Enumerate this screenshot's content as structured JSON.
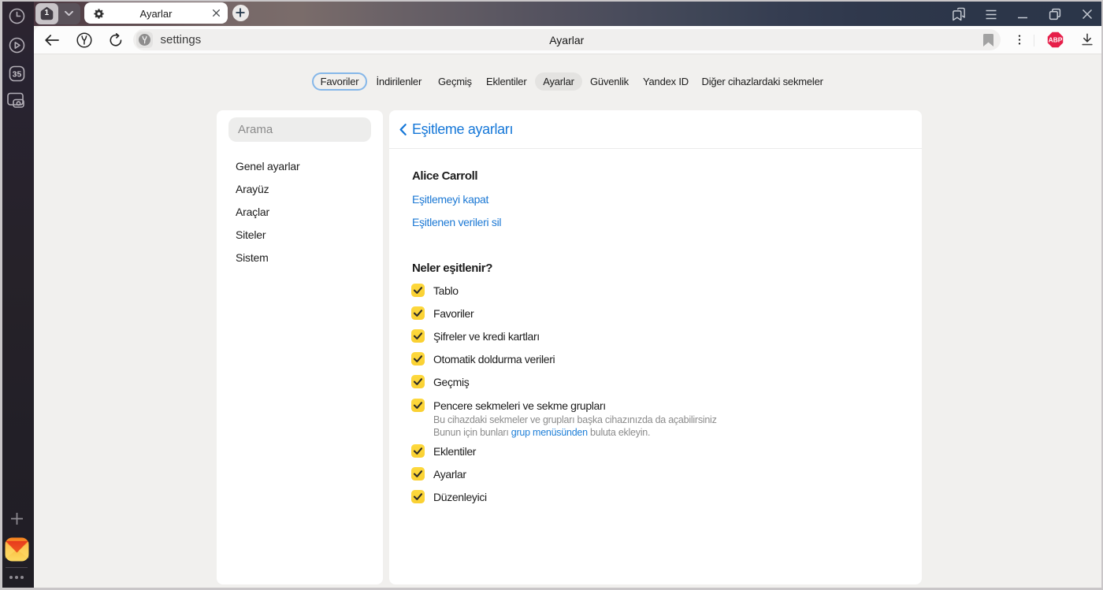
{
  "window": {
    "tab_count": "1",
    "tab_title": "Ayarlar",
    "page_title": "Ayarlar",
    "url_text": "settings"
  },
  "nav": {
    "items": [
      {
        "label": "Favoriler",
        "state": "outlined"
      },
      {
        "label": "İndirilenler",
        "state": "plain"
      },
      {
        "label": "Geçmiş",
        "state": "plain"
      },
      {
        "label": "Eklentiler",
        "state": "plain"
      },
      {
        "label": "Ayarlar",
        "state": "current"
      },
      {
        "label": "Güvenlik",
        "state": "plain"
      },
      {
        "label": "Yandex ID",
        "state": "plain"
      },
      {
        "label": "Diğer cihazlardaki sekmeler",
        "state": "plain"
      }
    ]
  },
  "sidebar_panel": {
    "search_placeholder": "Arama",
    "menu": [
      {
        "label": "Genel ayarlar"
      },
      {
        "label": "Arayüz"
      },
      {
        "label": "Araçlar"
      },
      {
        "label": "Siteler"
      },
      {
        "label": "Sistem"
      }
    ]
  },
  "sync_panel": {
    "title": "Eşitleme ayarları",
    "account_name": "Alice Carroll",
    "link_disable": "Eşitlemeyi kapat",
    "link_delete": "Eşitlenen verileri sil",
    "section_heading": "Neler eşitlenir?",
    "items": [
      {
        "label": "Tablo",
        "checked": true
      },
      {
        "label": "Favoriler",
        "checked": true
      },
      {
        "label": "Şifreler ve kredi kartları",
        "checked": true
      },
      {
        "label": "Otomatik doldurma verileri",
        "checked": true
      },
      {
        "label": "Geçmiş",
        "checked": true
      },
      {
        "label": "Pencere sekmeleri ve sekme grupları",
        "checked": true
      },
      {
        "label": "Eklentiler",
        "checked": true
      },
      {
        "label": "Ayarlar",
        "checked": true
      },
      {
        "label": "Düzenleyici",
        "checked": true
      }
    ],
    "note_line1": "Bu cihazdaki sekmeler ve grupları başka cihazınızda da açabilirsiniz",
    "note_line2_prefix": "Bunun için bunları ",
    "note_line2_link": "grup menüsünden",
    "note_line2_suffix": " buluta ekleyin."
  },
  "side_panel": {
    "tab_count_badge": "35"
  },
  "colors": {
    "accent_blue": "#1577d8",
    "checkbox_yellow": "#fbd337",
    "abp_red": "#e61e49"
  }
}
